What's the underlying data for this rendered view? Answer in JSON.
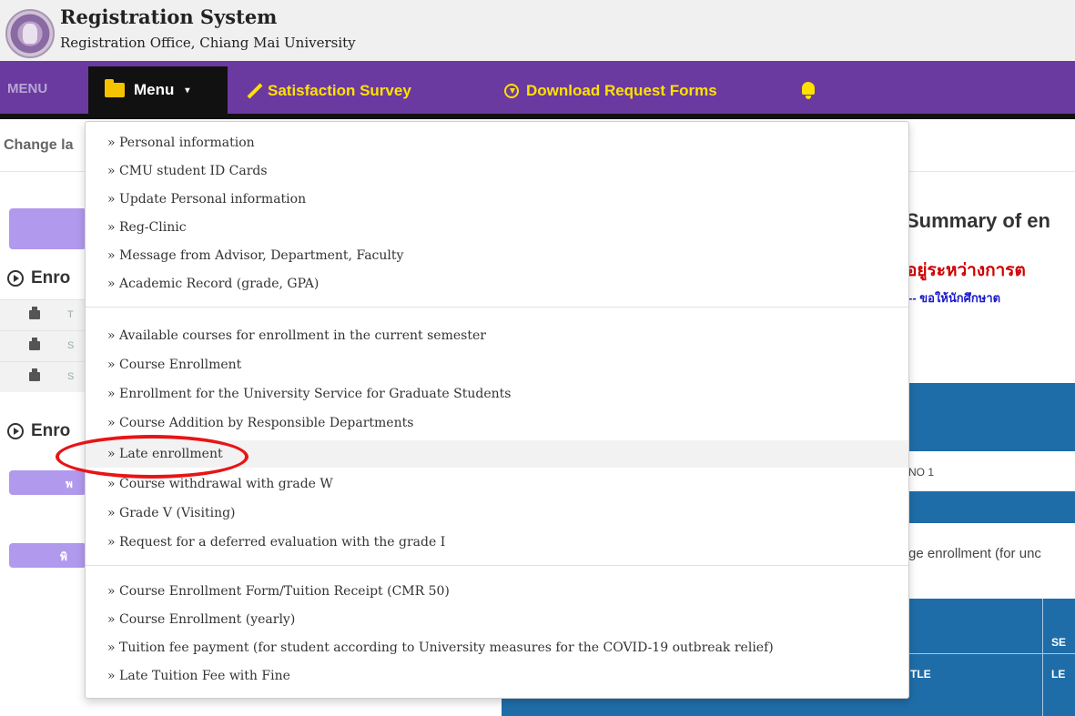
{
  "header": {
    "title": "Registration System",
    "subtitle": "Registration Office, Chiang Mai University"
  },
  "navbar": {
    "left_label": "MENU",
    "menu_label": "Menu",
    "survey_label": "Satisfaction Survey",
    "download_label": "Download Request Forms",
    "colors": {
      "bar": "#6a3aa0",
      "link": "#ffe100",
      "active": "#111111"
    }
  },
  "subbar": {
    "change_language": "Change la"
  },
  "background": {
    "section1_title": "Enro",
    "section2_title": "Enro",
    "left_btn_2": "พ",
    "left_btn_3": "พิ",
    "row_stubs": [
      "T",
      "S",
      "S"
    ],
    "summary_title": "Summary of en",
    "thai_heading": "อยู่ระหว่างการต",
    "thai_note": "-- ขอให้นักศึกษาต",
    "no1": "NO 1",
    "change_enrollment": "ge enrollment (for unc",
    "table_title": "TLE",
    "table_sec": "SE",
    "table_lec": "LE"
  },
  "dropdown": {
    "group1": [
      "» Personal information",
      "» CMU student ID Cards",
      "» Update Personal information",
      "» Reg-Clinic",
      "» Message from Advisor, Department, Faculty",
      "» Academic Record (grade, GPA)"
    ],
    "group2": [
      "» Available courses for enrollment in the current semester",
      "» Course Enrollment",
      "» Enrollment for the University Service for Graduate Students",
      "» Course Addition by Responsible Departments",
      "» Late enrollment",
      "» Course withdrawal with grade W",
      "» Grade V (Visiting)",
      "» Request for a deferred evaluation with the grade I"
    ],
    "group3": [
      "» Course Enrollment Form/Tuition Receipt (CMR 50)",
      "» Course Enrollment (yearly)",
      "» Tuition fee payment (for student according to University measures for the COVID-19 outbreak relief)",
      "» Late Tuition Fee with Fine"
    ],
    "highlighted_item": "» Late enrollment"
  },
  "annotation": {
    "color": "#e81416",
    "target": "Late enrollment"
  }
}
